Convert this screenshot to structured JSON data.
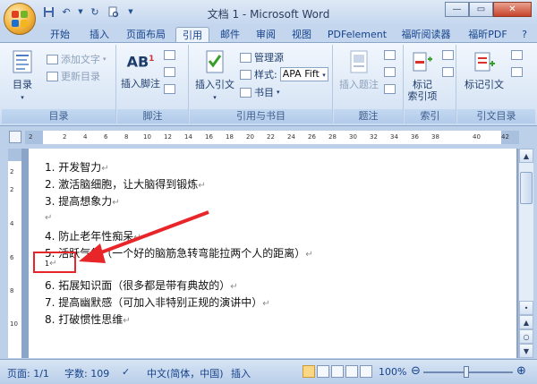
{
  "window": {
    "title": "文档 1 - Microsoft Word"
  },
  "ribbon_tabs": [
    "开始",
    "插入",
    "页面布局",
    "引用",
    "邮件",
    "审阅",
    "视图",
    "PDFelement",
    "福昕阅读器",
    "福昕PDF"
  ],
  "groups": {
    "toc": {
      "label": "目录",
      "big_button": "目录",
      "add_text": "添加文字",
      "update_toc": "更新目录"
    },
    "footnotes": {
      "label": "脚注",
      "insert_footnote": "插入脚注",
      "ab_glyph": "AB"
    },
    "citations": {
      "label": "引用与书目",
      "insert_citation": "插入引文",
      "manage_sources": "管理源",
      "style_label": "样式:",
      "style_value": "APA Fift",
      "bibliography": "书目"
    },
    "captions": {
      "label": "题注",
      "insert_caption": "插入题注"
    },
    "index": {
      "label": "索引",
      "mark_entry": "标记\n索引项"
    },
    "toa": {
      "label": "引文目录",
      "mark_citation": "标记引文"
    }
  },
  "ruler": {
    "h_ticks": [
      "2",
      "2",
      "4",
      "6",
      "8",
      "10",
      "12",
      "14",
      "16",
      "18",
      "20",
      "22",
      "24",
      "26",
      "28",
      "30",
      "32",
      "34",
      "36",
      "38",
      "40",
      "42"
    ],
    "v_ticks": [
      "2",
      "2",
      "4",
      "6",
      "8",
      "10"
    ]
  },
  "document": {
    "lines": [
      "1. 开发智力",
      "2. 激活脑细胞，让大脑得到锻炼",
      "3. 提高想象力",
      "",
      "4. 防止老年性痴呆",
      "5. 活跃气氛（一个好的脑筋急转弯能拉两个人的距离）",
      "1",
      "6. 拓展知识面（很多都是带有典故的）",
      "7. 提高幽默感（可加入非特别正规的演讲中）",
      "8. 打破惯性思维"
    ],
    "para_mark": "↵"
  },
  "status": {
    "page": "页面: 1/1",
    "words": "字数: 109",
    "language": "中文(简体，中国)",
    "mode": "插入",
    "zoom": "100%"
  },
  "colors": {
    "annotation": "#e8262a",
    "tab_text": "#15428b"
  }
}
